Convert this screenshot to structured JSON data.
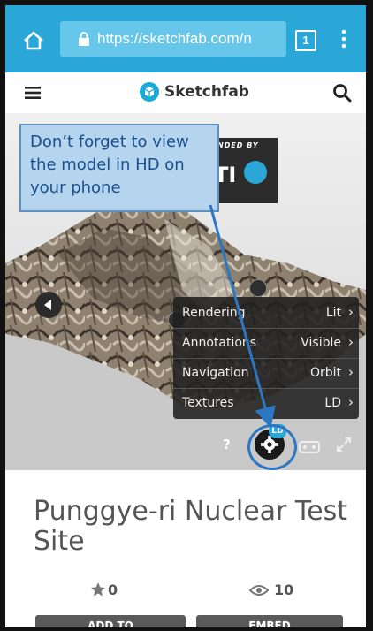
{
  "browser": {
    "url": "https://sketchfab.com/n",
    "tab_count": "1",
    "icons": {
      "home": "home-icon",
      "lock": "lock-icon",
      "menu": "more-vert-icon"
    },
    "accent_color": "#2aa7d6"
  },
  "site_header": {
    "brand_name": "Sketchfab",
    "icons": {
      "menu": "hamburger-icon",
      "logo": "sketchfab-logo-icon",
      "search": "search-icon"
    }
  },
  "callout": {
    "text": "Don’t forget to view\nthe model in HD on\nyour phone",
    "color": "#b5d4ee",
    "border_color": "#5d8fc2"
  },
  "viewer": {
    "sponsor_badge_top": "NDED BY",
    "sponsor_logo": "TI",
    "settings_menu": [
      {
        "label": "Rendering",
        "value": "Lit"
      },
      {
        "label": "Annotations",
        "value": "Visible"
      },
      {
        "label": "Navigation",
        "value": "Orbit"
      },
      {
        "label": "Textures",
        "value": "LD"
      }
    ],
    "help_label": "?",
    "quality_badge": "LD",
    "icons": {
      "settings": "gear-icon",
      "vr": "vr-headset-icon",
      "fullscreen": "fullscreen-icon",
      "prev": "chevron-left-icon"
    }
  },
  "model": {
    "title": "Punggye-ri Nuclear Test Site",
    "likes": "0",
    "views": "10"
  },
  "actions": {
    "add_to": "ADD TO",
    "embed": "EMBED"
  }
}
